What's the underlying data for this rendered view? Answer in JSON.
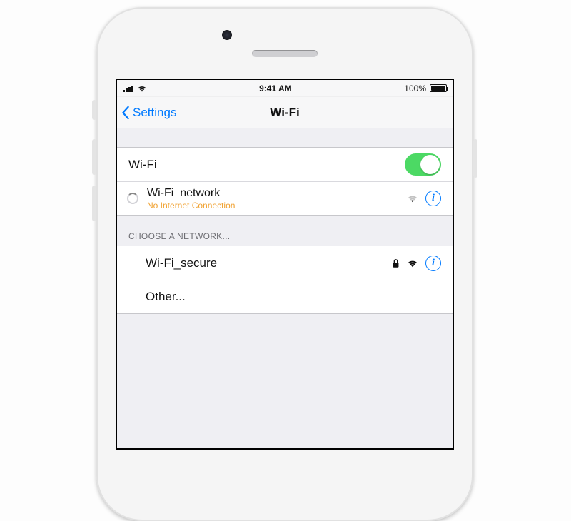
{
  "status": {
    "time": "9:41 AM",
    "battery_pct": "100%"
  },
  "nav": {
    "back_label": "Settings",
    "title": "Wi-Fi"
  },
  "wifi_toggle": {
    "label": "Wi-Fi",
    "on": true
  },
  "connected_network": {
    "name": "Wi-Fi_network",
    "status": "No Internet Connection"
  },
  "section_header": "Choose a Network...",
  "networks": [
    {
      "name": "Wi-Fi_secure",
      "secured": true
    }
  ],
  "other_label": "Other..."
}
